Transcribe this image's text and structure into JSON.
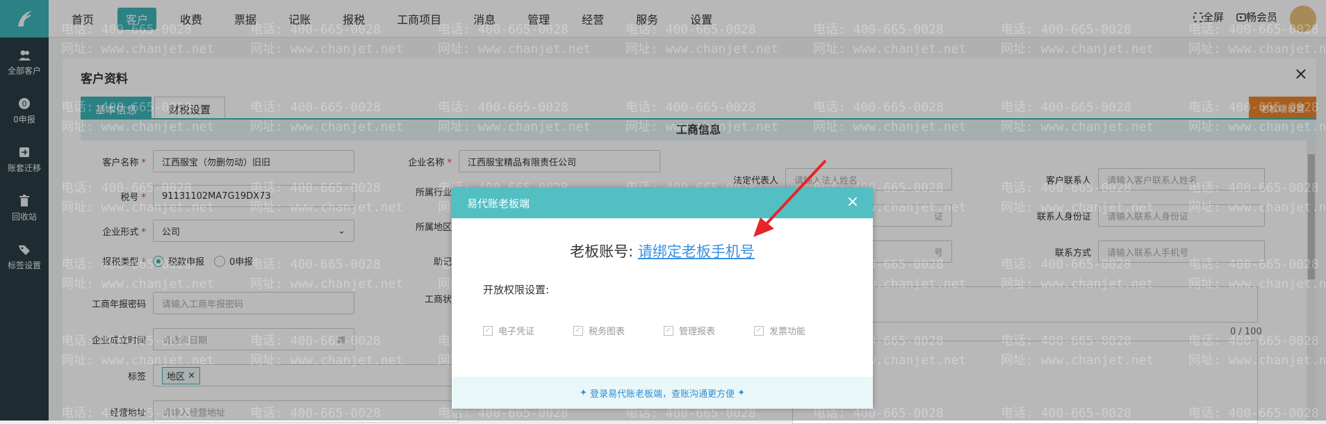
{
  "nav": [
    "首页",
    "客户",
    "收费",
    "票据",
    "记账",
    "报税",
    "工商项目",
    "消息",
    "管理",
    "经营",
    "服务",
    "设置"
  ],
  "nav_active": "客户",
  "top_right": {
    "fullscreen": "全屏",
    "member": "畅会员"
  },
  "sidebar": [
    {
      "label": "全部客户",
      "icon": "users-icon"
    },
    {
      "label": "0申报",
      "icon": "zero-declare-icon"
    },
    {
      "label": "账套迁移",
      "icon": "migrate-icon"
    },
    {
      "label": "回收站",
      "icon": "trash-icon"
    },
    {
      "label": "标签设置",
      "icon": "tag-icon"
    }
  ],
  "card": {
    "title": "客户资料",
    "tabs": [
      "基本信息",
      "财税设置"
    ],
    "boss_button": "老板端设置",
    "section": "工商信息"
  },
  "form_left": [
    {
      "label": "客户名称",
      "required": true,
      "value": "江西服宝（勿删勿动）旧旧",
      "placeholder": false
    },
    {
      "label": "税号",
      "required": true,
      "value": "91131102MA7G19DX73",
      "placeholder": false
    },
    {
      "label": "企业形式",
      "required": true,
      "value": "公司",
      "placeholder": false
    },
    {
      "label": "报税类型",
      "required": true
    },
    {
      "label": "工商年报密码",
      "required": false,
      "value": "请输入工商年报密码",
      "placeholder": true
    },
    {
      "label": "企业成立时间",
      "required": false,
      "value": "请选择日期",
      "placeholder": true
    },
    {
      "label": "标签",
      "required": false
    },
    {
      "label": "经营地址",
      "required": false,
      "value": "请输入经营地址",
      "placeholder": true
    }
  ],
  "tax_types": [
    "税款申报",
    "0申报"
  ],
  "tag_chip": "地区",
  "form_mid": [
    {
      "label": "企业名称",
      "required": true,
      "value": "江西服宝精品有限责任公司"
    },
    {
      "label": "所属行业"
    },
    {
      "label": "所属地区"
    },
    {
      "label": "助记"
    },
    {
      "label": "工商状"
    }
  ],
  "form_right": {
    "legal_rep_label": "法定代表人",
    "legal_rep_placeholder": "请输入法人姓名",
    "id_partial": "证",
    "phone_partial": "号",
    "contact_label": "客户联系人",
    "contact_placeholder": "请输入客户联系人姓名",
    "contact_id_label": "联系人身份证",
    "contact_id_placeholder": "请输入联系人身份证",
    "contact_phone_label": "联系方式",
    "contact_phone_placeholder": "请输入联系人手机号",
    "counter": "0 / 100"
  },
  "watermark": {
    "phone": "电话: 400-665-0028",
    "site": "网址: www.chanjet.net"
  },
  "modal": {
    "title": "易代账老板端",
    "account_label": "老板账号:",
    "account_link": "请绑定老板手机号",
    "perm_label": "开放权限设置:",
    "checks": [
      "电子凭证",
      "税务图表",
      "管理报表",
      "发票功能"
    ],
    "footer": "登录易代账老板端，查账沟通更方便"
  }
}
